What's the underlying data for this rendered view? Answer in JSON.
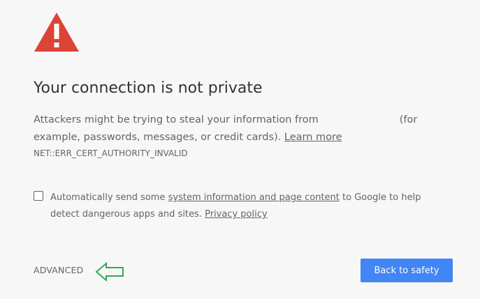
{
  "warning": {
    "icon": "warning-triangle-icon",
    "color": "#db4437"
  },
  "heading": "Your connection is not private",
  "description": {
    "before_host": "Attackers might be trying to steal your information from",
    "after_host": "(for example, passwords, messages, or credit cards).",
    "learn_more": "Learn more"
  },
  "error_code": "NET::ERR_CERT_AUTHORITY_INVALID",
  "report": {
    "checked": false,
    "text_before": "Automatically send some",
    "link": "system information and page content",
    "text_after": "to Google to help detect dangerous apps and sites.",
    "privacy_link": "Privacy policy"
  },
  "footer": {
    "advanced_label": "ADVANCED",
    "safety_button_label": "Back to safety",
    "button_color": "#4285f4",
    "arrow_icon": "green-arrow-left-icon",
    "arrow_color": "#34a853"
  }
}
